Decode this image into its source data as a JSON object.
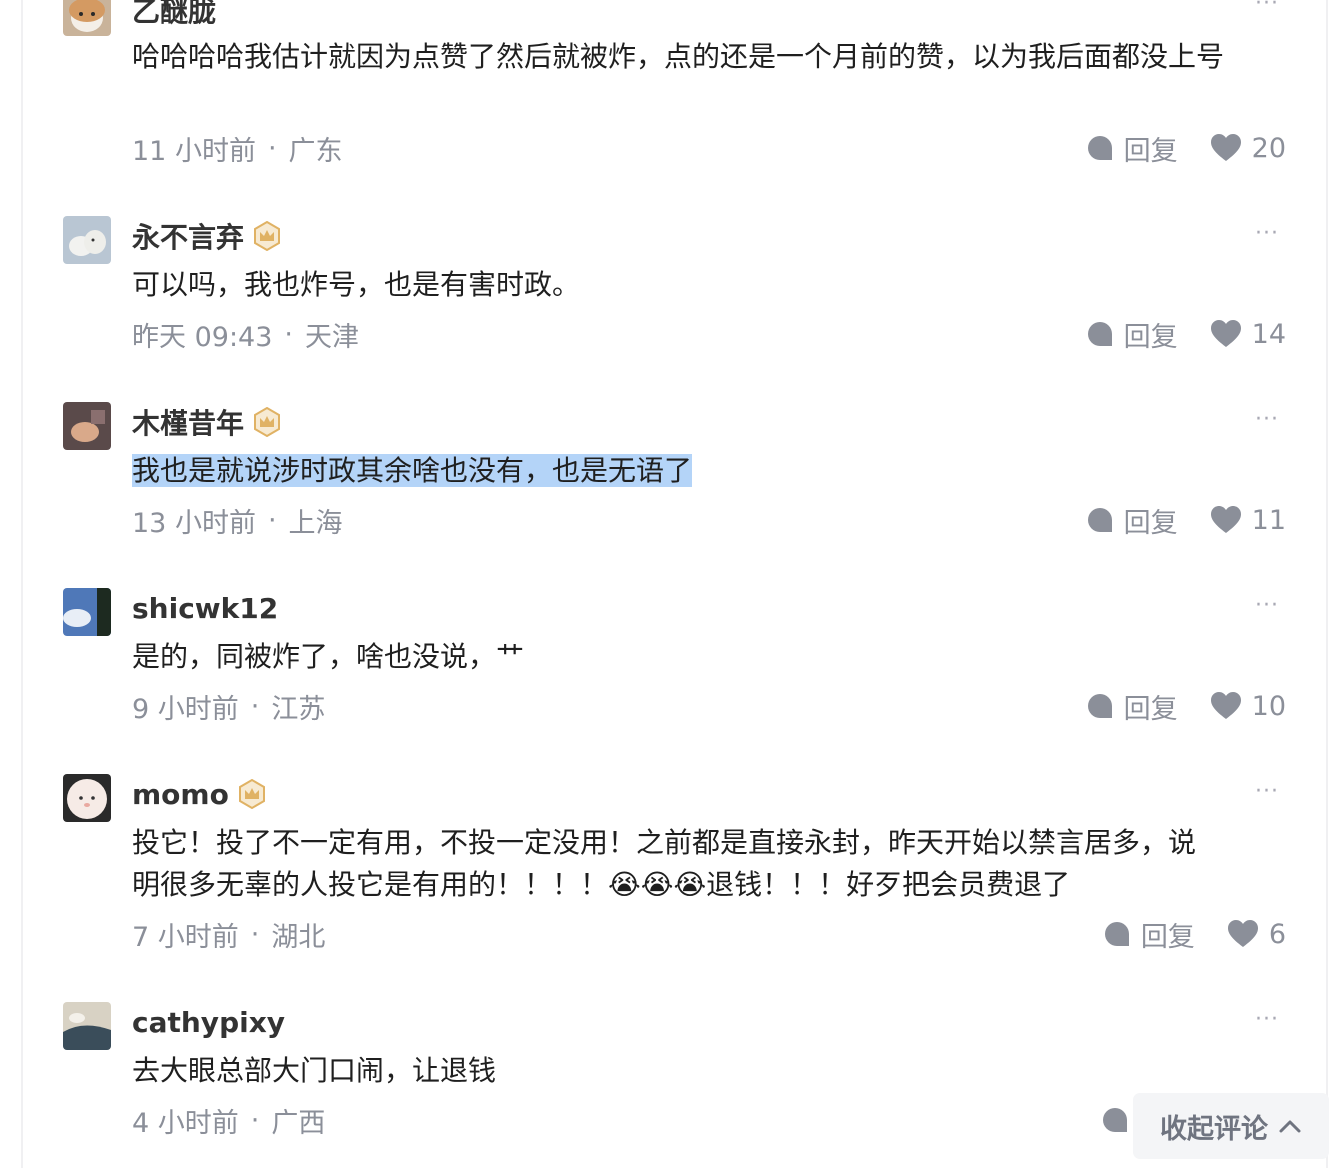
{
  "comments": [
    {
      "name": "乙醚胧",
      "content": "哈哈哈哈我估计就因为点赞了然后就被炸，点的还是一个月前的赞，以为我后面都没上号",
      "time": "11 小时前",
      "location": "广东",
      "reply_label": "回复",
      "likes": "20",
      "avatar_icon": "shiba-dog-avatar"
    },
    {
      "name": "永不言弃",
      "content": "可以吗，我也炸号，也是有害时政。",
      "time": "昨天 09:43",
      "location": "天津",
      "reply_label": "回复",
      "likes": "14",
      "badge": "crown-badge-icon",
      "avatar_icon": "polar-bear-avatar"
    },
    {
      "name": "木槿昔年",
      "content": "我也是就说涉时政其余啥也没有，也是无语了",
      "time": "13 小时前",
      "location": "上海",
      "reply_label": "回复",
      "likes": "11",
      "badge": "crown-badge-icon",
      "avatar_icon": "photo-avatar"
    },
    {
      "name": "shicwk12",
      "content": "是的，同被炸了，啥也没说，艹",
      "time": "9 小时前",
      "location": "江苏",
      "reply_label": "回复",
      "likes": "10",
      "avatar_icon": "sky-avatar"
    },
    {
      "name": "momo",
      "content_line1": "投它！投了不一定有用，不投一定没用！之前都是直接永封，昨天开始以禁言居多，说",
      "content_line2_a": "明很多无辜的人投它是有用的！！！！",
      "content_emoji": "😭😭😭",
      "content_line2_b": "退钱！！！好歹把会员费退了",
      "time": "7 小时前",
      "location": "湖北",
      "reply_label": "回复",
      "likes": "6",
      "badge": "crown-badge-icon",
      "avatar_icon": "cartoon-face-avatar"
    },
    {
      "name": "cathypixy",
      "content": "去大眼总部大门口闹，让退钱",
      "time": "4 小时前",
      "location": "广西",
      "avatar_icon": "landscape-avatar"
    }
  ],
  "more_label": "···",
  "collapse_label": "收起评论",
  "colors": {
    "meta_gray": "#8b8f99",
    "highlight": "#b4d4f8",
    "badge_gold": "#e0b264"
  }
}
